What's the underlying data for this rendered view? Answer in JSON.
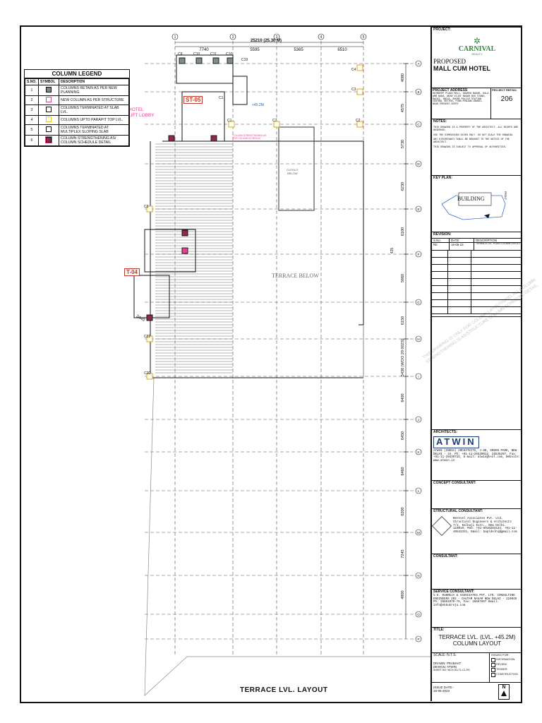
{
  "drawing": {
    "title": "TERRACE LVL. LAYOUT",
    "overall_dim": "25210 (25.30 M)",
    "top_dims": [
      "7740",
      "5595",
      "5365",
      "6510"
    ],
    "grid_cols": [
      "①",
      "②",
      "③",
      "④",
      "⑤"
    ],
    "grid_rows": [
      "Ⓐ",
      "Ⓑ",
      "Ⓒ",
      "Ⓓ",
      "Ⓔ",
      "Ⓕ",
      "Ⓖ",
      "Ⓗ",
      "Ⓘ",
      "Ⓙ",
      "Ⓚ",
      "Ⓛ",
      "Ⓜ",
      "Ⓝ",
      "Ⓞ",
      "Ⓟ"
    ],
    "right_dims": [
      "4080",
      "4575",
      "5730",
      "6230",
      "6100",
      "5660",
      "6150",
      "5430 (WOO 20 002S)",
      "6400",
      "6450",
      "6460",
      "6200",
      "7245",
      "4800"
    ],
    "column_tags": [
      "C9",
      "C10",
      "C11",
      "C10",
      "C19",
      "C4",
      "C3",
      "C1",
      "C1",
      "C7",
      "C2",
      "C3",
      "C20",
      "C22"
    ],
    "labels": {
      "hotel_lift": "HOTEL\nLIFT LOBBY",
      "terrace_below": "TERRACE BELOW",
      "level_marker": "+45.2M",
      "cutout": "CUTOUT\nBELOW",
      "dim_3440": "3440",
      "dim_425": "425",
      "strengthening_note": "COLUMN STRENGTHENING AS PER COLUMN SCHEDULE",
      "watermark": "THIS DRAWING IS ONLY FOR COLUMN LAYOUT/GRID. ALL COLUMN STRENGTHENING IS AS/STRUCTURE COLUMN SCHEDULE DETAIL."
    },
    "tags": {
      "st05": "ST-05",
      "t04": "T-04"
    }
  },
  "legend": {
    "title": "COLUMN LEGEND",
    "headers": [
      "S.NO.",
      "SYMBOL",
      "DESCRIPTION"
    ],
    "rows": [
      {
        "no": "1",
        "desc": "COLUMNS RETAIN AS PER NEW PLANNING",
        "color": "#7f8c8d"
      },
      {
        "no": "2",
        "desc": "NEW COLUMN AS PER STRUCTURE",
        "color": "#e84393"
      },
      {
        "no": "3",
        "desc": "COLUMNS TERMINATED AT SLAB LVL.",
        "color": "#ffffff"
      },
      {
        "no": "4",
        "desc": "COLUMNS UPTO PARAPIT TOP LVL.",
        "color": "#f1c40f"
      },
      {
        "no": "5",
        "desc": "COLUMNS TERMINATED AT MULTIPLEX SLOPING SLAB",
        "color": "#ffffff"
      },
      {
        "no": "6",
        "desc": "COLUMN STRENGTHENING AS/ COLUMN SCHEDULE DETAIL",
        "color": "#8e2a4a"
      }
    ]
  },
  "title_block": {
    "project_label": "PROJECT:",
    "logo_text": "CARNIVAL",
    "logo_sub": "REALTY",
    "project_name_1": "PROPOSED",
    "project_name_2": "MALL CUM HOTEL",
    "address_label": "PROJECT ADDRESS",
    "ref_label": "PROJECT REF.No.",
    "ref_no": "206",
    "address_text": "RATNDEEP PLAZA MALL, ADARSH NAGAR, KALA AMB NAKA, NEAR VIJAY NAGAR BUS STAND, RACHI, INDIA, BHORE POLICE STATION CENTRAL SECTOR, PUNE/PUNJAB/JHANSI, NEAR PRESENT ENTRY",
    "notes_label": "NOTES:",
    "notes": [
      "THIS DRAWING IS A PROPERTY OF THE ARCHITECT. ALL RIGHTS ARE RESERVED.",
      "USE THE DIMENSIONS GIVEN ONLY. DO NOT SCALE THE DRAWING.",
      "ANY DISCREPANCY SHALL BE BROUGHT TO THE NOTICE OF THE ARCHITECT.",
      "THIS DRAWING IS SUBJECT TO APPROVAL OF AUTHORITIES."
    ],
    "key_plan_label": "KEY PLAN:",
    "key_plan_building": "BUILDING",
    "key_plan_front": "FRONT",
    "revision_label": "REVISION:",
    "revision_headers": [
      "S.No.",
      "DATE",
      "DESCRIPTION"
    ],
    "revision_rows": [
      {
        "no": "R0",
        "date": "16-05-23",
        "desc": "TERRACE LVL. PLAN COLUMN LAYOUT"
      }
    ],
    "architects_label": "ARCHITECTS:",
    "architect_logo": "ATWIN",
    "architect_text": "ATWIN (INDIA) ARCHITECTS, J-88, GREEN PARK, NEW DELHI - 16. Ph: +91-11-26530013, 26536207, Fax: +91-11-26530733, E-mail: atwin@vsnl.com, Website: www.atwin.in",
    "concept_label": "CONCEPT CONSULTANT:",
    "structural_label": "STRUCTURAL CONSULTANT:",
    "structural_text": "Bentvel Associates Pvt. Ltd. Structural Engineers & Architects 7/3, Kalkaji Extn., New Delhi. 110019, Mob: +91-9810283434, +91-11-46542331, Email: bapldelhi@gmail.com",
    "consultant_label": "CONSULTANT:",
    "service_label": "SERVICE CONSULTANT:",
    "service_text": "V.K. KUKREJA & ASSOCIATES PVT. LTD. CONSULTING ENGINEERS 203 - GAUTAM NAGAR NEW DELHI - 110049 Ph: 26861070-79, Fax: 26867667 Email: info@vkkukreja.com",
    "title_label": "TITLE:",
    "sheet_title_1": "TERRACE LVL.  (LVL. +45.2M)",
    "sheet_title_2": "COLUMN LAYOUT",
    "scale": "SCALE: N.T.S.",
    "drawn": "DRAWN: PRABHAT",
    "design": "DESIGN: ATWIN",
    "sheet_no": "SHEET NO: MCH-SD-TL-CL-R0",
    "issued": "ISSUED FOR:",
    "issue_items": [
      "INFORMATION",
      "REVIEW",
      "TENDER",
      "CONSTRUCTION"
    ],
    "issue_date_label": "ISSUE DATE:-",
    "issue_date": "16-05-2023",
    "north": "N"
  }
}
